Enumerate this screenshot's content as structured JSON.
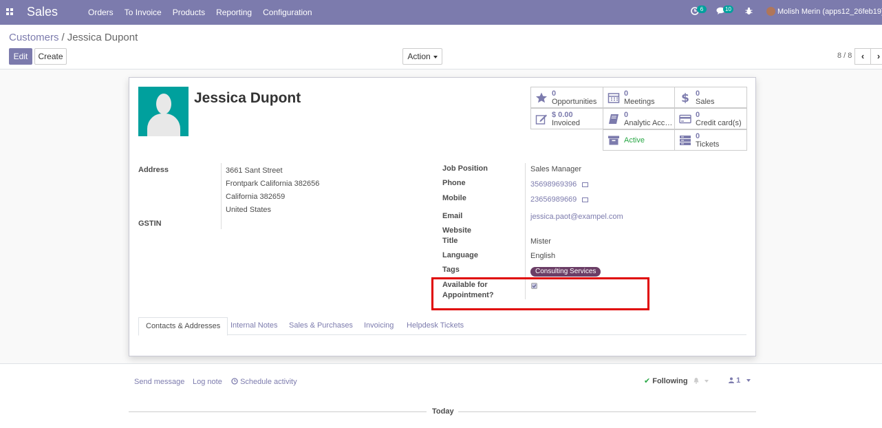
{
  "app": {
    "brand": "Sales"
  },
  "topmenu": [
    "Orders",
    "To Invoice",
    "Products",
    "Reporting",
    "Configuration"
  ],
  "systray": {
    "activity_count": "6",
    "message_count": "10",
    "user": "Molish Merin (apps12_26feb19)"
  },
  "breadcrumb": {
    "parent": "Customers",
    "separator": "/",
    "current": "Jessica Dupont"
  },
  "buttons": {
    "edit": "Edit",
    "create": "Create",
    "action": "Action"
  },
  "pager": {
    "value": "8 / 8",
    "prev": "‹",
    "next": "›"
  },
  "partner": {
    "name": "Jessica Dupont"
  },
  "stat_buttons": [
    {
      "icon": "star-icon",
      "value": "0",
      "label": "Opportunities"
    },
    {
      "icon": "calendar-icon",
      "value": "0",
      "label": "Meetings"
    },
    {
      "icon": "dollar-icon",
      "value": "0",
      "label": "Sales"
    },
    {
      "icon": "pencil-square-icon",
      "value": "$ 0.00",
      "label": "Invoiced"
    },
    {
      "icon": "book-icon",
      "value": "0",
      "label": "Analytic Acco..."
    },
    {
      "icon": "credit-card-icon",
      "value": "0",
      "label": "Credit card(s)"
    },
    {
      "icon": "archive-icon",
      "value": "",
      "label": "Active"
    },
    {
      "icon": "server-icon",
      "value": "0",
      "label": "Tickets"
    }
  ],
  "left_fields": {
    "address_label": "Address",
    "address_lines": [
      "3661 Sant Street",
      "Frontpark California 382656",
      "California  382659",
      "United States"
    ],
    "gstin_label": "GSTIN"
  },
  "right_fields": {
    "job_position": {
      "label": "Job Position",
      "value": "Sales Manager"
    },
    "phone": {
      "label": "Phone",
      "value": "35698969396"
    },
    "mobile": {
      "label": "Mobile",
      "value": "23656989669"
    },
    "email": {
      "label": "Email",
      "value": "jessica.paot@exampel.com"
    },
    "website": {
      "label": "Website",
      "value": ""
    },
    "title": {
      "label": "Title",
      "value": "Mister"
    },
    "language": {
      "label": "Language",
      "value": "English"
    },
    "tags": {
      "label": "Tags",
      "value": "Consulting Services",
      "color": "#6b3e66"
    },
    "appointment": {
      "label_line1": "Available for",
      "label_line2": "Appointment?",
      "checked": true
    }
  },
  "tabs": [
    "Contacts & Addresses",
    "Internal Notes",
    "Sales & Purchases",
    "Invoicing",
    "Helpdesk Tickets"
  ],
  "chatter": {
    "send_message": "Send message",
    "log_note": "Log note",
    "schedule_activity": "Schedule activity",
    "following": "Following",
    "followers_count": "1",
    "today": "Today"
  },
  "colors": {
    "navbar": "#7c7bad",
    "accent": "#7c7bad",
    "highlight_box": "#e00000",
    "avatar_bg": "#00a09d"
  }
}
